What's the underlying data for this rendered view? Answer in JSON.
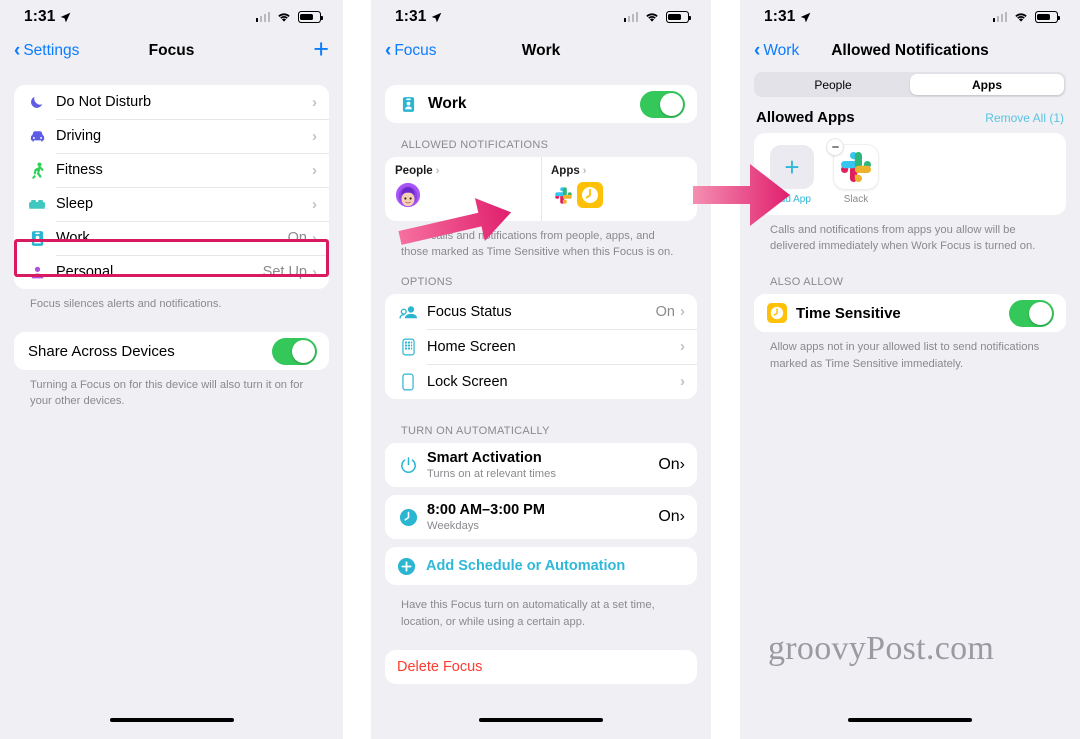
{
  "status_bar": {
    "time": "1:31",
    "location_icon": "location-arrow-icon",
    "signal_icon": "cellular-bars-icon",
    "wifi_icon": "wifi-icon",
    "battery_icon": "battery-icon"
  },
  "panel1": {
    "nav": {
      "back_label": "Settings",
      "title": "Focus",
      "add_label": "+"
    },
    "focus_list": [
      {
        "label": "Do Not Disturb",
        "value": "",
        "icon": "moon-icon"
      },
      {
        "label": "Driving",
        "value": "",
        "icon": "car-icon"
      },
      {
        "label": "Fitness",
        "value": "",
        "icon": "running-person-icon"
      },
      {
        "label": "Sleep",
        "value": "",
        "icon": "bed-icon"
      },
      {
        "label": "Work",
        "value": "On",
        "icon": "id-badge-icon"
      },
      {
        "label": "Personal",
        "value": "Set Up",
        "icon": "person-icon"
      }
    ],
    "focus_footer": "Focus silences alerts and notifications.",
    "share": {
      "label": "Share Across Devices",
      "toggle": "on"
    },
    "share_footer": "Turning a Focus on for this device will also turn it on for your other devices."
  },
  "panel2": {
    "nav": {
      "back_label": "Focus",
      "title": "Work"
    },
    "work_toggle": {
      "label": "Work",
      "icon": "id-badge-icon",
      "toggle": "on"
    },
    "allowed_header": "ALLOWED NOTIFICATIONS",
    "people_card": {
      "title": "People",
      "icon": "avatar-memoji-icon"
    },
    "apps_card": {
      "title": "Apps",
      "icons": [
        "slack-icon",
        "clock-time-sensitive-icon"
      ]
    },
    "allowed_footer": "Allow calls and notifications from people, apps, and those marked as Time Sensitive when this Focus is on.",
    "options_header": "OPTIONS",
    "options": [
      {
        "label": "Focus Status",
        "value": "On",
        "icon": "focus-status-icon"
      },
      {
        "label": "Home Screen",
        "value": "",
        "icon": "home-screen-icon"
      },
      {
        "label": "Lock Screen",
        "value": "",
        "icon": "lock-screen-icon"
      }
    ],
    "auto_header": "TURN ON AUTOMATICALLY",
    "automations": [
      {
        "title": "Smart Activation",
        "subtitle": "Turns on at relevant times",
        "value": "On",
        "icon": "power-icon"
      },
      {
        "title": "8:00 AM–3:00 PM",
        "subtitle": "Weekdays",
        "value": "On",
        "icon": "clock-icon"
      }
    ],
    "add_schedule_label": "Add Schedule or Automation",
    "auto_footer": "Have this Focus turn on automatically at a set time, location, or while using a certain app.",
    "delete_label": "Delete Focus"
  },
  "panel3": {
    "nav": {
      "back_label": "Work",
      "title": "Allowed Notifications"
    },
    "segments": [
      {
        "label": "People",
        "selected": false
      },
      {
        "label": "Apps",
        "selected": true
      }
    ],
    "allowed_apps_header": "Allowed Apps",
    "remove_all_label": "Remove All (1)",
    "apps": [
      {
        "caption": "Add App",
        "type": "add",
        "icon": "plus-icon"
      },
      {
        "caption": "Slack",
        "type": "app",
        "icon": "slack-icon",
        "badge": "minus-badge-icon"
      }
    ],
    "apps_footer": "Calls and notifications from apps you allow will be delivered immediately when Work Focus is turned on.",
    "also_allow_header": "ALSO ALLOW",
    "time_sensitive": {
      "label": "Time Sensitive",
      "icon": "clock-time-sensitive-icon",
      "toggle": "on"
    },
    "time_sensitive_footer": "Allow apps not in your allowed list to send notifications marked as Time Sensitive immediately."
  },
  "annotations": {
    "highlight_color": "#d81b60",
    "arrow_color": "#e8357f",
    "arrow1_name": "arrow-people-to-apps",
    "arrow2_name": "arrow-apps-to-allowed-apps"
  },
  "watermark": {
    "text": "groovyPost.com"
  },
  "colors": {
    "accent_blue": "#0a7cff",
    "teal": "#2fb8d8",
    "green": "#34c759",
    "red": "#ff3b30",
    "bg": "#f0eff4"
  }
}
